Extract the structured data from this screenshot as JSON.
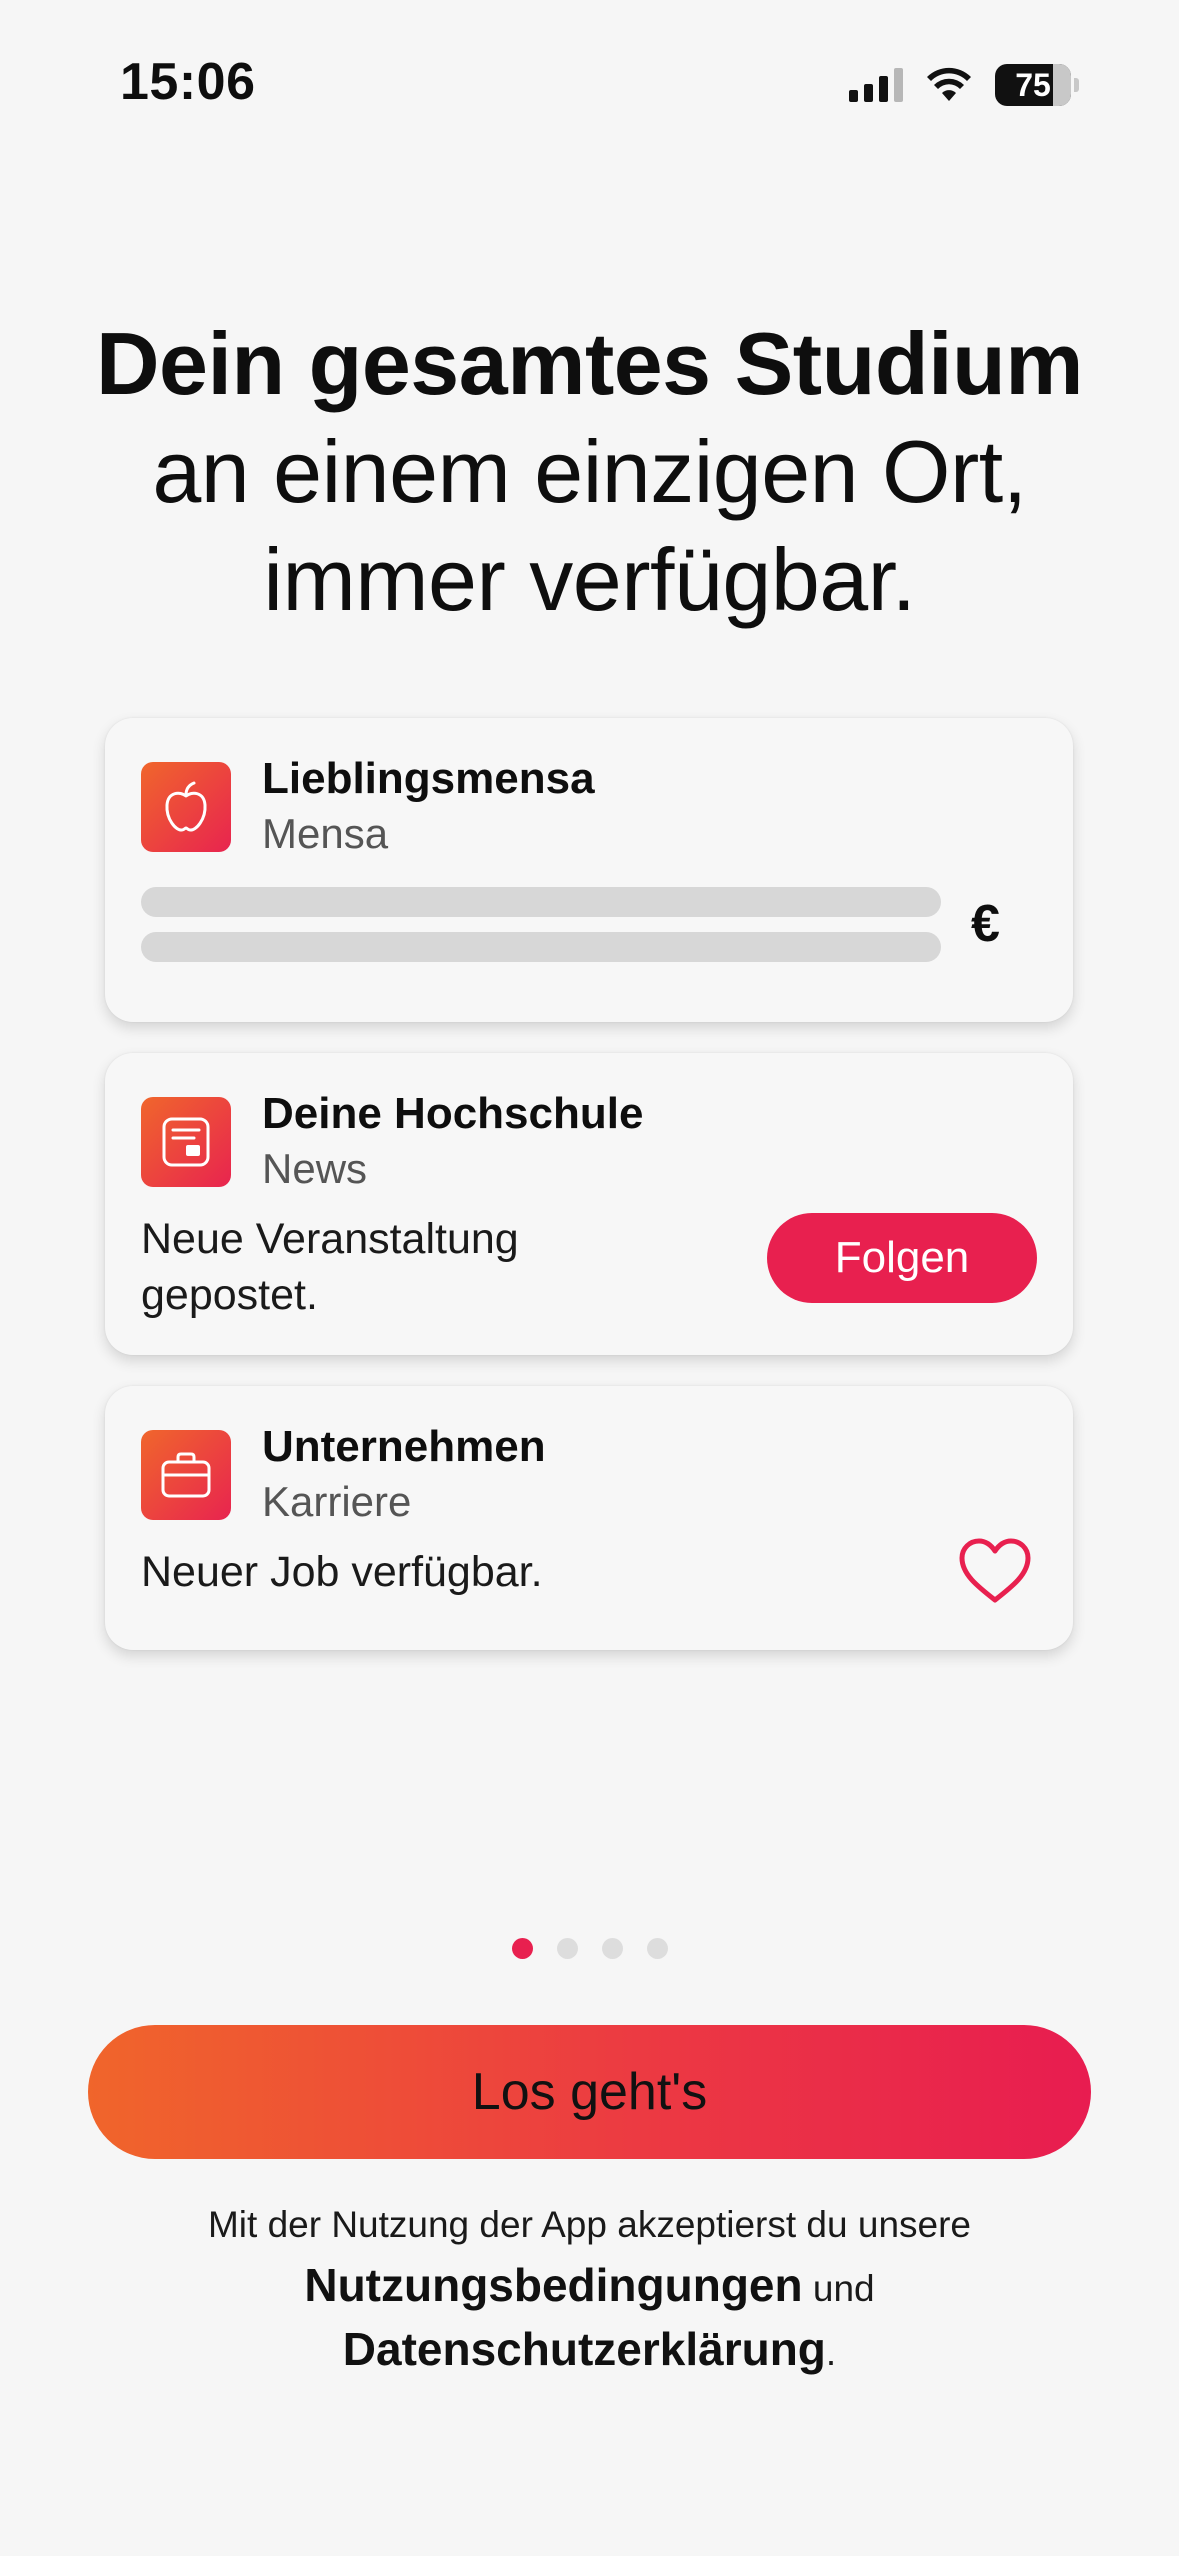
{
  "status_bar": {
    "time": "15:06",
    "battery": "75"
  },
  "headline": {
    "line1": "Dein gesamtes Studium",
    "line2": "an einem einzigen Ort,",
    "line3": "immer verfügbar."
  },
  "cards": [
    {
      "title": "Lieblingsmensa",
      "subtitle": "Mensa",
      "icon": "apple-icon",
      "price_symbol": "€"
    },
    {
      "title": "Deine Hochschule",
      "subtitle": "News",
      "icon": "newspaper-icon",
      "body_line1": "Neue Veranstaltung",
      "body_line2": "gepostet.",
      "button_label": "Folgen"
    },
    {
      "title": "Unternehmen",
      "subtitle": "Karriere",
      "icon": "briefcase-icon",
      "body": "Neuer Job verfügbar.",
      "action_icon": "heart-icon"
    }
  ],
  "pager": {
    "total": 4,
    "active": 1
  },
  "cta": {
    "label": "Los geht's"
  },
  "legal": {
    "prefix": "Mit der Nutzung der App akzeptierst  du unsere",
    "terms": "Nutzungsbedingungen",
    "and": "und",
    "privacy": "Datenschutzerklärung",
    "suffix": "."
  },
  "colors": {
    "accent": "#e8204f",
    "gradient_start": "#f0652b",
    "gradient_end": "#e81c50",
    "background": "#f6f6f6"
  }
}
